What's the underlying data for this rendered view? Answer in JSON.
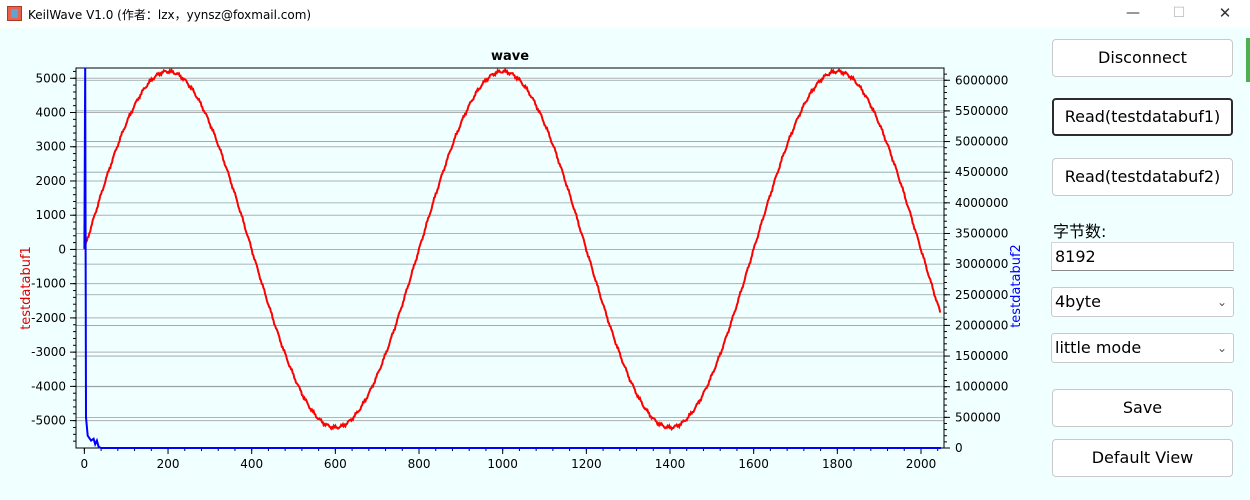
{
  "window": {
    "title": "KeilWave V1.0 (作者：lzx，yynsz@foxmail.com)"
  },
  "titlebar": {
    "min": "—",
    "max": "☐",
    "close": "✕"
  },
  "buttons": {
    "disconnect": "Disconnect",
    "read1": "Read(testdatabuf1)",
    "read2": "Read(testdatabuf2)",
    "save": "Save",
    "default_view": "Default View"
  },
  "bytes_label": "字节数:",
  "bytes_value": "8192",
  "byte_type": "4byte",
  "endian": "little mode",
  "chart_data": {
    "type": "line",
    "title": "wave",
    "xlabel": "",
    "ylabel_left": "testdatabuf1",
    "ylabel_right": "testdatabuf2",
    "xlim": [
      -20,
      2055
    ],
    "ylim_left": [
      -5800,
      5300
    ],
    "ylim_right": [
      0,
      6200000
    ],
    "x_ticks": [
      "0",
      "200",
      "400",
      "600",
      "800",
      "1000",
      "1200",
      "1400",
      "1600",
      "1800",
      "2000"
    ],
    "y_left_ticks": [
      "5000",
      "4000",
      "3000",
      "2000",
      "1000",
      "0",
      "-1000",
      "-2000",
      "-3000",
      "-4000",
      "-5000"
    ],
    "y_right_ticks": [
      "6000000",
      "5500000",
      "5000000",
      "4500000",
      "4000000",
      "3500000",
      "3000000",
      "2500000",
      "2000000",
      "1500000",
      "1000000",
      "500000",
      "0"
    ],
    "grid": true,
    "series": [
      {
        "name": "testdatabuf1",
        "color": "#ff0000",
        "axis": "left",
        "amplitude": 5200,
        "period": 800,
        "length": 2048
      },
      {
        "name": "testdatabuf2",
        "color": "#0000ff",
        "axis": "right",
        "points": [
          [
            0,
            3250000
          ],
          [
            2,
            6200000
          ],
          [
            4,
            500000
          ],
          [
            8,
            200000
          ],
          [
            12,
            160000
          ],
          [
            16,
            120000
          ],
          [
            22,
            150000
          ],
          [
            26,
            60000
          ],
          [
            30,
            120000
          ],
          [
            34,
            20000
          ],
          [
            40,
            0
          ],
          [
            2048,
            0
          ]
        ]
      }
    ]
  }
}
